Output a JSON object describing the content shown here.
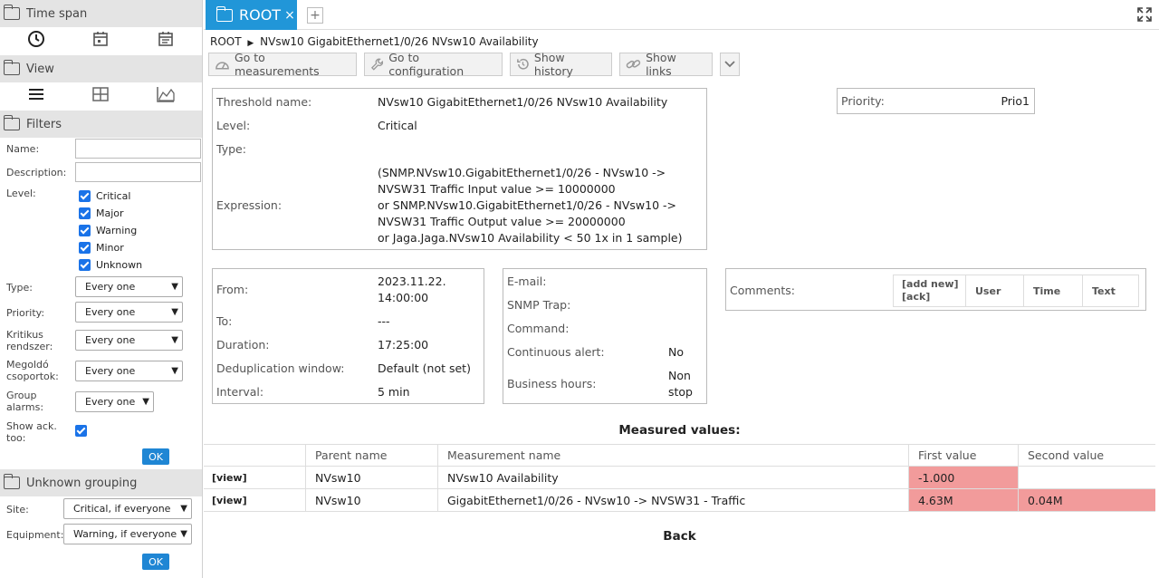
{
  "sidebar": {
    "time_span": {
      "title": "Time span",
      "icons": [
        "clock-icon",
        "calendar-icon",
        "calendar-range-icon"
      ]
    },
    "view": {
      "title": "View",
      "icons": [
        "list-icon",
        "grid-icon",
        "chart-icon"
      ]
    },
    "filters": {
      "title": "Filters",
      "name_label": "Name:",
      "name_value": "",
      "description_label": "Description:",
      "description_value": "",
      "level_label": "Level:",
      "levels": [
        {
          "label": "Critical",
          "checked": true
        },
        {
          "label": "Major",
          "checked": true
        },
        {
          "label": "Warning",
          "checked": true
        },
        {
          "label": "Minor",
          "checked": true
        },
        {
          "label": "Unknown",
          "checked": true
        }
      ],
      "type_label": "Type:",
      "type_value": "Every one",
      "priority_label": "Priority:",
      "priority_value": "Every one",
      "kritikus_label": "Kritikus rendszer:",
      "kritikus_value": "Every one",
      "megoldo_label": "Megoldó csoportok:",
      "megoldo_value": "Every one",
      "group_label": "Group alarms:",
      "group_value": "Every one",
      "show_ack_label": "Show ack. too:",
      "show_ack_checked": true,
      "ok_label": "OK"
    },
    "unknown_grouping": {
      "title": "Unknown grouping",
      "site_label": "Site:",
      "site_value": "Critical, if everyone",
      "equipment_label": "Equipment:",
      "equipment_value": "Warning, if everyone",
      "ok_label": "OK"
    }
  },
  "tabs": [
    {
      "label": "ROOT",
      "close": "×"
    }
  ],
  "tab_add": "+",
  "breadcrumb": {
    "root": "ROOT",
    "separator": "▶",
    "item": "NVsw10 GigabitEthernet1/0/26 NVsw10 Availability"
  },
  "toolbar": {
    "go_measurements": "Go to measurements",
    "go_configuration": "Go to configuration",
    "show_history": "Show history",
    "show_links": "Show links"
  },
  "threshold": {
    "name_label": "Threshold name:",
    "name_value": "NVsw10 GigabitEthernet1/0/26 NVsw10 Availability",
    "level_label": "Level:",
    "level_value": "Critical",
    "type_label": "Type:",
    "type_value": "",
    "expression_label": "Expression:",
    "expression_lines": [
      "(SNMP.NVsw10.GigabitEthernet1/0/26 - NVsw10 ->",
      "NVSW31 Traffic Input value >= 10000000",
      "or SNMP.NVsw10.GigabitEthernet1/0/26 - NVsw10 ->",
      "NVSW31 Traffic Output value >= 20000000",
      "or Jaga.Jaga.NVsw10 Availability < 50 1x in 1 sample)"
    ]
  },
  "priority": {
    "label": "Priority:",
    "value": "Prio1"
  },
  "timing": {
    "from_label": "From:",
    "from_date": "2023.11.22.",
    "from_time": "14:00:00",
    "to_label": "To:",
    "to_value": "---",
    "duration_label": "Duration:",
    "duration_value": "17:25:00",
    "dedup_label": "Deduplication window:",
    "dedup_value": "Default (not set)",
    "interval_label": "Interval:",
    "interval_value": "5 min"
  },
  "alerting": {
    "email_label": "E-mail:",
    "snmp_label": "SNMP Trap:",
    "command_label": "Command:",
    "continuous_label": "Continuous alert:",
    "continuous_value": "No",
    "business_label": "Business hours:",
    "business_value_1": "Non",
    "business_value_2": "stop"
  },
  "comments": {
    "label": "Comments:",
    "add_new": "[add new]",
    "ack": "[ack]",
    "user": "User",
    "time": "Time",
    "text": "Text"
  },
  "measured": {
    "title": "Measured values:",
    "headers": [
      "",
      "Parent name",
      "Measurement name",
      "First value",
      "Second value"
    ],
    "rows": [
      {
        "view": "[view]",
        "parent": "NVsw10",
        "measurement": "NVsw10 Availability",
        "first": "-1.000",
        "second": ""
      },
      {
        "view": "[view]",
        "parent": "NVsw10",
        "measurement": "GigabitEthernet1/0/26 - NVsw10 -> NVSW31 - Traffic",
        "first": "4.63M",
        "second": "0.04M"
      }
    ]
  },
  "back": "Back",
  "colors": {
    "accent": "#2196d8",
    "alert": "#f29b9b"
  }
}
